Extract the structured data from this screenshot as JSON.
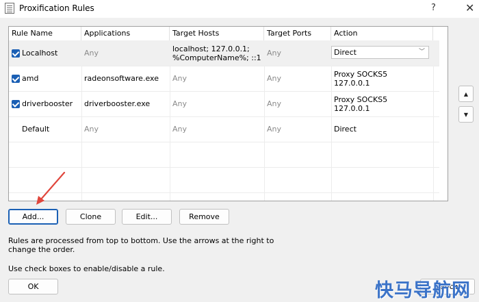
{
  "window": {
    "title": "Proxification Rules",
    "help": "?",
    "close": "✕"
  },
  "grid": {
    "columns": [
      "Rule Name",
      "Applications",
      "Target Hosts",
      "Target Ports",
      "Action"
    ],
    "rows": [
      {
        "checked": true,
        "name": "Localhost",
        "applications": "Any",
        "target_hosts": "localhost; 127.0.0.1;\n%ComputerName%; ::1",
        "target_ports": "Any",
        "action": "Direct",
        "selected": true
      },
      {
        "checked": true,
        "name": "amd",
        "applications": "radeonsoftware.exe",
        "target_hosts": "Any",
        "target_ports": "Any",
        "action": "Proxy SOCKS5\n127.0.0.1"
      },
      {
        "checked": true,
        "name": "driverbooster",
        "applications": "driverbooster.exe",
        "target_hosts": "Any",
        "target_ports": "Any",
        "action": "Proxy SOCKS5\n127.0.0.1"
      },
      {
        "checked": false,
        "name": "Default",
        "applications": "Any",
        "target_hosts": "Any",
        "target_ports": "Any",
        "action": "Direct"
      }
    ]
  },
  "move": {
    "up": "▲",
    "down": "▼"
  },
  "buttons": {
    "add": "Add...",
    "clone": "Clone",
    "edit": "Edit...",
    "remove": "Remove",
    "ok": "OK",
    "cancel": "Cancel"
  },
  "info": {
    "line1": "Rules are processed from top to bottom. Use the arrows at the right to change the order.",
    "line2": "Use check boxes to enable/disable a rule."
  },
  "watermark": "快马导航网"
}
